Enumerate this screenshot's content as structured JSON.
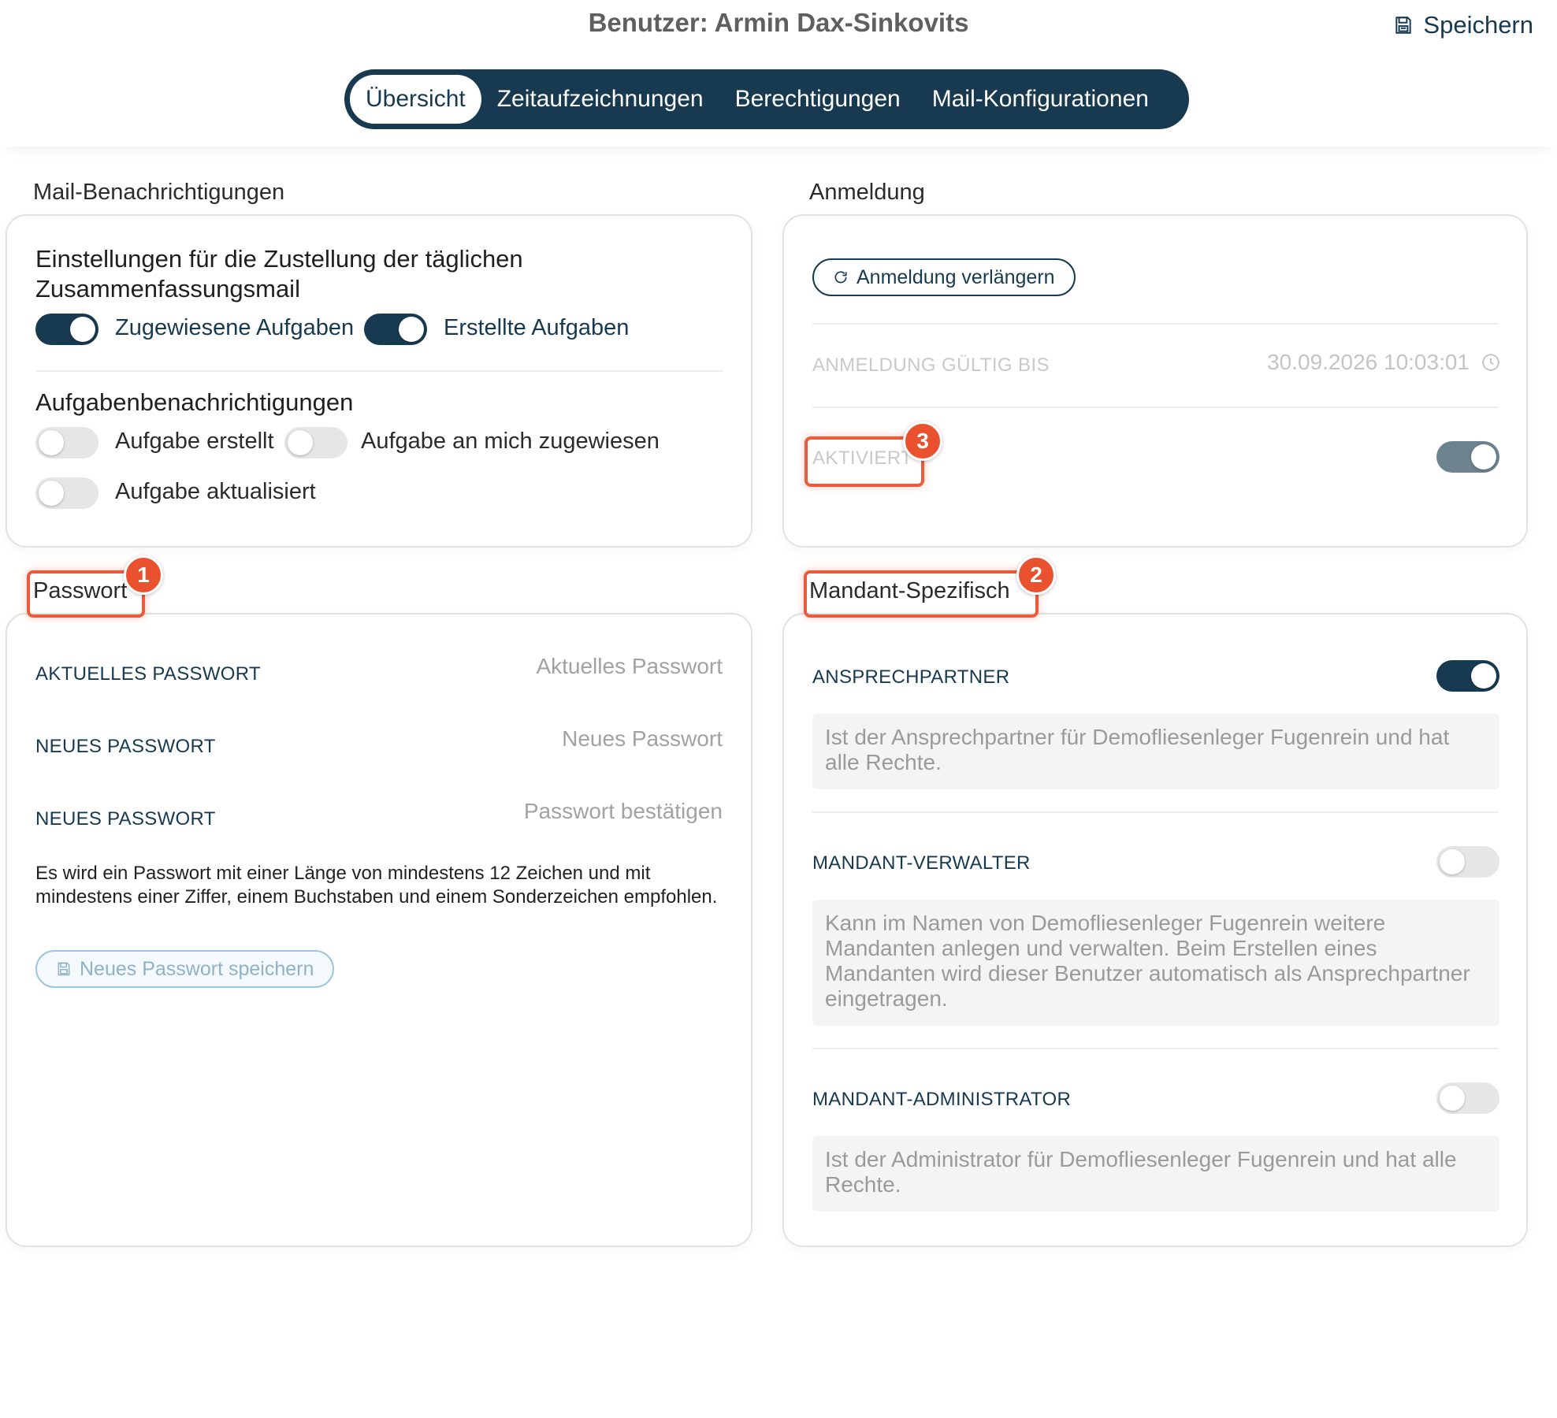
{
  "header": {
    "title": "Benutzer: Armin Dax-Sinkovits",
    "save_label": "Speichern",
    "tabs": [
      {
        "label": "Übersicht",
        "active": true
      },
      {
        "label": "Zeitaufzeichnungen",
        "active": false
      },
      {
        "label": "Berechtigungen",
        "active": false
      },
      {
        "label": "Mail-Konfigurationen",
        "active": false
      }
    ]
  },
  "mail": {
    "section_label": "Mail-Benachrichtigungen",
    "summary_title": "Einstellungen für die Zustellung der täglichen Zusammenfassungsmail",
    "summary_toggles": [
      {
        "label": "Zugewiesene Aufgaben",
        "on": true
      },
      {
        "label": "Erstellte Aufgaben",
        "on": true
      }
    ],
    "task_title": "Aufgabenbenachrichtigungen",
    "task_toggles": [
      {
        "label": "Aufgabe erstellt",
        "on": false
      },
      {
        "label": "Aufgabe an mich zugewiesen",
        "on": false
      },
      {
        "label": "Aufgabe aktualisiert",
        "on": false
      }
    ]
  },
  "login": {
    "section_label": "Anmeldung",
    "extend_button": "Anmeldung verlängern",
    "valid_until_label": "ANMELDUNG GÜLTIG BIS",
    "valid_until_value": "30.09.2026 10:03:01",
    "activated_label": "AKTIVIERT",
    "activated_on": true
  },
  "password": {
    "section_label": "Passwort",
    "fields": [
      {
        "label": "AKTUELLES PASSWORT",
        "placeholder": "Aktuelles Passwort"
      },
      {
        "label": "NEUES PASSWORT",
        "placeholder": "Neues Passwort"
      },
      {
        "label": "NEUES PASSWORT",
        "placeholder": "Passwort bestätigen"
      }
    ],
    "hint": "Es wird ein Passwort mit einer Länge von mindestens 12 Zeichen und mit mindestens einer Ziffer, einem Buchstaben und einem Sonderzeichen empfohlen.",
    "save_button": "Neues Passwort speichern"
  },
  "tenant": {
    "section_label": "Mandant-Spezifisch",
    "items": [
      {
        "label": "ANSPRECHPARTNER",
        "on": true,
        "description": "Ist der Ansprechpartner für Demofliesenleger Fugenrein und hat alle Rechte."
      },
      {
        "label": "MANDANT-VERWALTER",
        "on": false,
        "description": "Kann im Namen von Demofliesenleger Fugenrein weitere Mandanten anlegen und verwalten. Beim Erstellen eines Mandanten wird dieser Benutzer automatisch als Ansprechpartner eingetragen."
      },
      {
        "label": "MANDANT-ADMINISTRATOR",
        "on": false,
        "description": "Ist der Administrator für Demofliesenleger Fugenrein und hat alle Rechte."
      }
    ]
  },
  "annotations": [
    "1",
    "2",
    "3"
  ],
  "colors": {
    "accent": "#173a50",
    "highlight": "#ed5a3b",
    "border": "#e2e2e2"
  }
}
